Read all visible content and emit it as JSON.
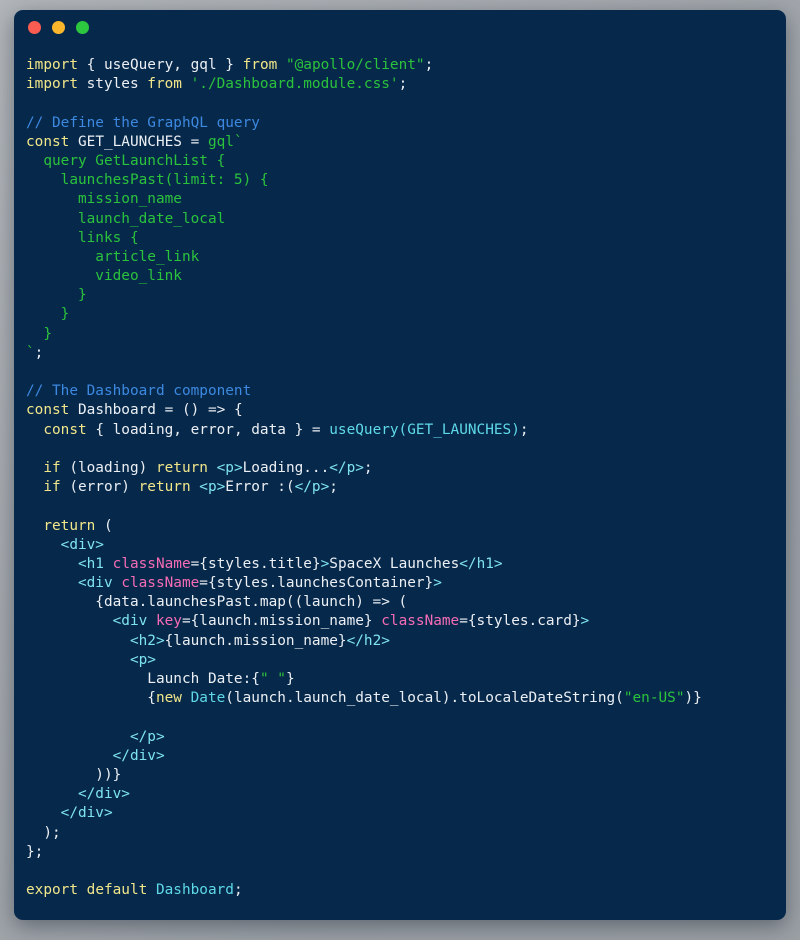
{
  "window": {
    "traffic_lights": [
      {
        "name": "close",
        "color": "#fb5c51"
      },
      {
        "name": "minimize",
        "color": "#fbb72c"
      },
      {
        "name": "maximize",
        "color": "#2dc73f"
      }
    ],
    "background_color": "#06294b",
    "page_background_color": "#a3a7ac"
  },
  "theme": {
    "plain": "#eceff4",
    "keyword": "#f2e68a",
    "string": "#2bc23c",
    "comment": "#3d88e0",
    "jsx_tag": "#7fe3ef",
    "jsx_attribute": "#f56bb5",
    "function": "#5fd9e8"
  },
  "code": {
    "language": "jsx",
    "lines": [
      {
        "n": 1,
        "tokens": [
          {
            "t": "import",
            "c": "kw"
          },
          {
            "t": " ",
            "c": "plain"
          },
          {
            "t": "{ useQuery, gql }",
            "c": "plain"
          },
          {
            "t": " ",
            "c": "plain"
          },
          {
            "t": "from",
            "c": "kw"
          },
          {
            "t": " ",
            "c": "plain"
          },
          {
            "t": "\"@apollo/client\"",
            "c": "str"
          },
          {
            "t": ";",
            "c": "plain"
          }
        ]
      },
      {
        "n": 2,
        "tokens": [
          {
            "t": "import",
            "c": "kw"
          },
          {
            "t": " styles ",
            "c": "plain"
          },
          {
            "t": "from",
            "c": "kw"
          },
          {
            "t": " ",
            "c": "plain"
          },
          {
            "t": "'./Dashboard.module.css'",
            "c": "str"
          },
          {
            "t": ";",
            "c": "plain"
          }
        ]
      },
      {
        "n": 3,
        "tokens": []
      },
      {
        "n": 4,
        "tokens": [
          {
            "t": "// Define the GraphQL query",
            "c": "comment"
          }
        ]
      },
      {
        "n": 5,
        "tokens": [
          {
            "t": "const",
            "c": "kw"
          },
          {
            "t": " GET_LAUNCHES = ",
            "c": "plain"
          },
          {
            "t": "gql`",
            "c": "str"
          }
        ]
      },
      {
        "n": 6,
        "tokens": [
          {
            "t": "  query GetLaunchList {",
            "c": "gql"
          }
        ]
      },
      {
        "n": 7,
        "tokens": [
          {
            "t": "    launchesPast(limit: 5) {",
            "c": "gql"
          }
        ]
      },
      {
        "n": 8,
        "tokens": [
          {
            "t": "      mission_name",
            "c": "gql"
          }
        ]
      },
      {
        "n": 9,
        "tokens": [
          {
            "t": "      launch_date_local",
            "c": "gql"
          }
        ]
      },
      {
        "n": 10,
        "tokens": [
          {
            "t": "      links {",
            "c": "gql"
          }
        ]
      },
      {
        "n": 11,
        "tokens": [
          {
            "t": "        article_link",
            "c": "gql"
          }
        ]
      },
      {
        "n": 12,
        "tokens": [
          {
            "t": "        video_link",
            "c": "gql"
          }
        ]
      },
      {
        "n": 13,
        "tokens": [
          {
            "t": "      }",
            "c": "gql"
          }
        ]
      },
      {
        "n": 14,
        "tokens": [
          {
            "t": "    }",
            "c": "gql"
          }
        ]
      },
      {
        "n": 15,
        "tokens": [
          {
            "t": "  }",
            "c": "gql"
          }
        ]
      },
      {
        "n": 16,
        "tokens": [
          {
            "t": "`",
            "c": "str"
          },
          {
            "t": ";",
            "c": "plain"
          }
        ]
      },
      {
        "n": 17,
        "tokens": []
      },
      {
        "n": 18,
        "tokens": [
          {
            "t": "// The Dashboard component",
            "c": "comment"
          }
        ]
      },
      {
        "n": 19,
        "tokens": [
          {
            "t": "const",
            "c": "kw"
          },
          {
            "t": " Dashboard = () => {",
            "c": "plain"
          }
        ]
      },
      {
        "n": 20,
        "tokens": [
          {
            "t": "  ",
            "c": "plain"
          },
          {
            "t": "const",
            "c": "kw"
          },
          {
            "t": " { loading, error, data } = ",
            "c": "plain"
          },
          {
            "t": "useQuery(GET_LAUNCHES)",
            "c": "fn"
          },
          {
            "t": ";",
            "c": "plain"
          }
        ]
      },
      {
        "n": 21,
        "tokens": []
      },
      {
        "n": 22,
        "tokens": [
          {
            "t": "  ",
            "c": "plain"
          },
          {
            "t": "if",
            "c": "kw"
          },
          {
            "t": " (loading) ",
            "c": "plain"
          },
          {
            "t": "return",
            "c": "kw"
          },
          {
            "t": " ",
            "c": "plain"
          },
          {
            "t": "<p>",
            "c": "tag"
          },
          {
            "t": "Loading...",
            "c": "plain"
          },
          {
            "t": "</p>",
            "c": "tag"
          },
          {
            "t": ";",
            "c": "plain"
          }
        ]
      },
      {
        "n": 23,
        "tokens": [
          {
            "t": "  ",
            "c": "plain"
          },
          {
            "t": "if",
            "c": "kw"
          },
          {
            "t": " (error) ",
            "c": "plain"
          },
          {
            "t": "return",
            "c": "kw"
          },
          {
            "t": " ",
            "c": "plain"
          },
          {
            "t": "<p>",
            "c": "tag"
          },
          {
            "t": "Error :(",
            "c": "plain"
          },
          {
            "t": "</p>",
            "c": "tag"
          },
          {
            "t": ";",
            "c": "plain"
          }
        ]
      },
      {
        "n": 24,
        "tokens": []
      },
      {
        "n": 25,
        "tokens": [
          {
            "t": "  ",
            "c": "plain"
          },
          {
            "t": "return",
            "c": "kw"
          },
          {
            "t": " (",
            "c": "plain"
          }
        ]
      },
      {
        "n": 26,
        "tokens": [
          {
            "t": "    ",
            "c": "plain"
          },
          {
            "t": "<div>",
            "c": "tag"
          }
        ]
      },
      {
        "n": 27,
        "tokens": [
          {
            "t": "      ",
            "c": "plain"
          },
          {
            "t": "<h1",
            "c": "tag"
          },
          {
            "t": " ",
            "c": "plain"
          },
          {
            "t": "className",
            "c": "attr"
          },
          {
            "t": "={styles.title}",
            "c": "plain"
          },
          {
            "t": ">",
            "c": "tag"
          },
          {
            "t": "SpaceX Launches",
            "c": "plain"
          },
          {
            "t": "</h1>",
            "c": "tag"
          }
        ]
      },
      {
        "n": 28,
        "tokens": [
          {
            "t": "      ",
            "c": "plain"
          },
          {
            "t": "<div",
            "c": "tag"
          },
          {
            "t": " ",
            "c": "plain"
          },
          {
            "t": "className",
            "c": "attr"
          },
          {
            "t": "={styles.launchesContainer}",
            "c": "plain"
          },
          {
            "t": ">",
            "c": "tag"
          }
        ]
      },
      {
        "n": 29,
        "tokens": [
          {
            "t": "        {data.launchesPast.map((launch) => (",
            "c": "plain"
          }
        ]
      },
      {
        "n": 30,
        "tokens": [
          {
            "t": "          ",
            "c": "plain"
          },
          {
            "t": "<div",
            "c": "tag"
          },
          {
            "t": " ",
            "c": "plain"
          },
          {
            "t": "key",
            "c": "attr"
          },
          {
            "t": "={launch.mission_name} ",
            "c": "plain"
          },
          {
            "t": "className",
            "c": "attr"
          },
          {
            "t": "={styles.card}",
            "c": "plain"
          },
          {
            "t": ">",
            "c": "tag"
          }
        ]
      },
      {
        "n": 31,
        "tokens": [
          {
            "t": "            ",
            "c": "plain"
          },
          {
            "t": "<h2>",
            "c": "tag"
          },
          {
            "t": "{launch.mission_name}",
            "c": "plain"
          },
          {
            "t": "</h2>",
            "c": "tag"
          }
        ]
      },
      {
        "n": 32,
        "tokens": [
          {
            "t": "            ",
            "c": "plain"
          },
          {
            "t": "<p>",
            "c": "tag"
          }
        ]
      },
      {
        "n": 33,
        "tokens": [
          {
            "t": "              Launch Date:{",
            "c": "plain"
          },
          {
            "t": "\" \"",
            "c": "str"
          },
          {
            "t": "}",
            "c": "plain"
          }
        ]
      },
      {
        "n": 34,
        "tokens": [
          {
            "t": "              {",
            "c": "plain"
          },
          {
            "t": "new",
            "c": "kw"
          },
          {
            "t": " ",
            "c": "plain"
          },
          {
            "t": "Date",
            "c": "fn"
          },
          {
            "t": "(launch.launch_date_local).toLocaleDateString(",
            "c": "plain"
          },
          {
            "t": "\"en-US\"",
            "c": "str"
          },
          {
            "t": ")}",
            "c": "plain"
          }
        ]
      },
      {
        "n": 35,
        "tokens": []
      },
      {
        "n": 36,
        "tokens": [
          {
            "t": "            ",
            "c": "plain"
          },
          {
            "t": "</p>",
            "c": "tag"
          }
        ]
      },
      {
        "n": 37,
        "tokens": [
          {
            "t": "          ",
            "c": "plain"
          },
          {
            "t": "</div>",
            "c": "tag"
          }
        ]
      },
      {
        "n": 38,
        "tokens": [
          {
            "t": "        ))}",
            "c": "plain"
          }
        ]
      },
      {
        "n": 39,
        "tokens": [
          {
            "t": "      ",
            "c": "plain"
          },
          {
            "t": "</div>",
            "c": "tag"
          }
        ]
      },
      {
        "n": 40,
        "tokens": [
          {
            "t": "    ",
            "c": "plain"
          },
          {
            "t": "</div>",
            "c": "tag"
          }
        ]
      },
      {
        "n": 41,
        "tokens": [
          {
            "t": "  );",
            "c": "plain"
          }
        ]
      },
      {
        "n": 42,
        "tokens": [
          {
            "t": "};",
            "c": "plain"
          }
        ]
      },
      {
        "n": 43,
        "tokens": []
      },
      {
        "n": 44,
        "tokens": [
          {
            "t": "export",
            "c": "kw"
          },
          {
            "t": " ",
            "c": "plain"
          },
          {
            "t": "default",
            "c": "kw"
          },
          {
            "t": " ",
            "c": "plain"
          },
          {
            "t": "Dashboard",
            "c": "fn"
          },
          {
            "t": ";",
            "c": "plain"
          }
        ]
      }
    ]
  }
}
